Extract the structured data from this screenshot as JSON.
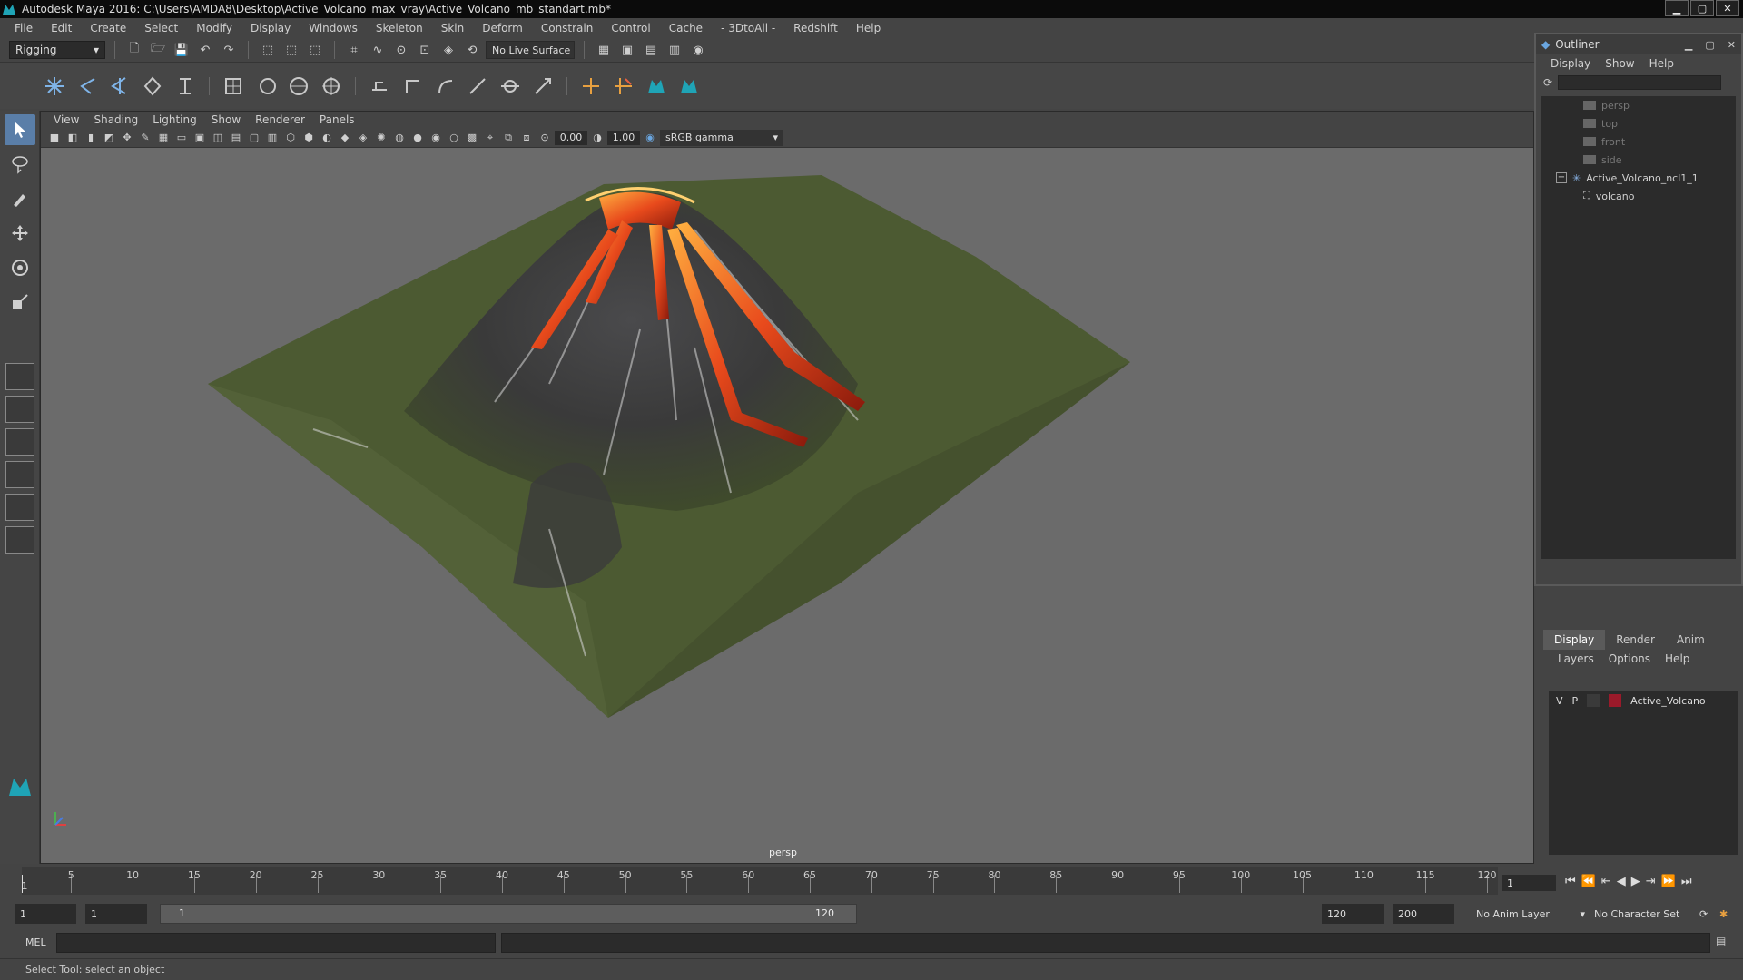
{
  "window": {
    "title": "Autodesk Maya 2016: C:\\Users\\AMDA8\\Desktop\\Active_Volcano_max_vray\\Active_Volcano_mb_standart.mb*",
    "minimize": "▁",
    "maximize": "▢",
    "close": "✕"
  },
  "menubar": {
    "items": [
      "File",
      "Edit",
      "Create",
      "Select",
      "Modify",
      "Display",
      "Windows",
      "Skeleton",
      "Skin",
      "Deform",
      "Constrain",
      "Control",
      "Cache",
      "- 3DtoAll -",
      "Redshift",
      "Help"
    ]
  },
  "statusline": {
    "mode": "Rigging",
    "live_surface": "No Live Surface"
  },
  "viewport": {
    "menu": [
      "View",
      "Shading",
      "Lighting",
      "Show",
      "Renderer",
      "Panels"
    ],
    "near_value": "0.00",
    "gamma_value": "1.00",
    "colorspace": "sRGB gamma",
    "camera": "persp"
  },
  "outliner": {
    "title": "Outliner",
    "menu": [
      "Display",
      "Show",
      "Help"
    ],
    "cameras": [
      "persp",
      "top",
      "front",
      "side"
    ],
    "group": "Active_Volcano_ncl1_1",
    "child": "volcano"
  },
  "layers": {
    "tabs": [
      "Display",
      "Render",
      "Anim"
    ],
    "menu": [
      "Layers",
      "Options",
      "Help"
    ],
    "row": {
      "v": "V",
      "p": "P",
      "name": "Active_Volcano",
      "color": "#9a1a2a"
    }
  },
  "timeline": {
    "ticks": [
      "5",
      "10",
      "15",
      "20",
      "25",
      "30",
      "35",
      "40",
      "45",
      "50",
      "55",
      "60",
      "65",
      "70",
      "75",
      "80",
      "85",
      "90",
      "95",
      "100",
      "105",
      "110",
      "115",
      "120"
    ],
    "current_marker": "1",
    "current_frame": "1"
  },
  "range": {
    "start": "1",
    "playback_start": "1",
    "bar_start": "1",
    "bar_end": "120",
    "playback_end": "120",
    "end": "200",
    "anim_layer": "No Anim Layer",
    "char_set": "No Character Set"
  },
  "cmdline": {
    "label": "MEL"
  },
  "helpline": {
    "text": "Select Tool: select an object"
  }
}
